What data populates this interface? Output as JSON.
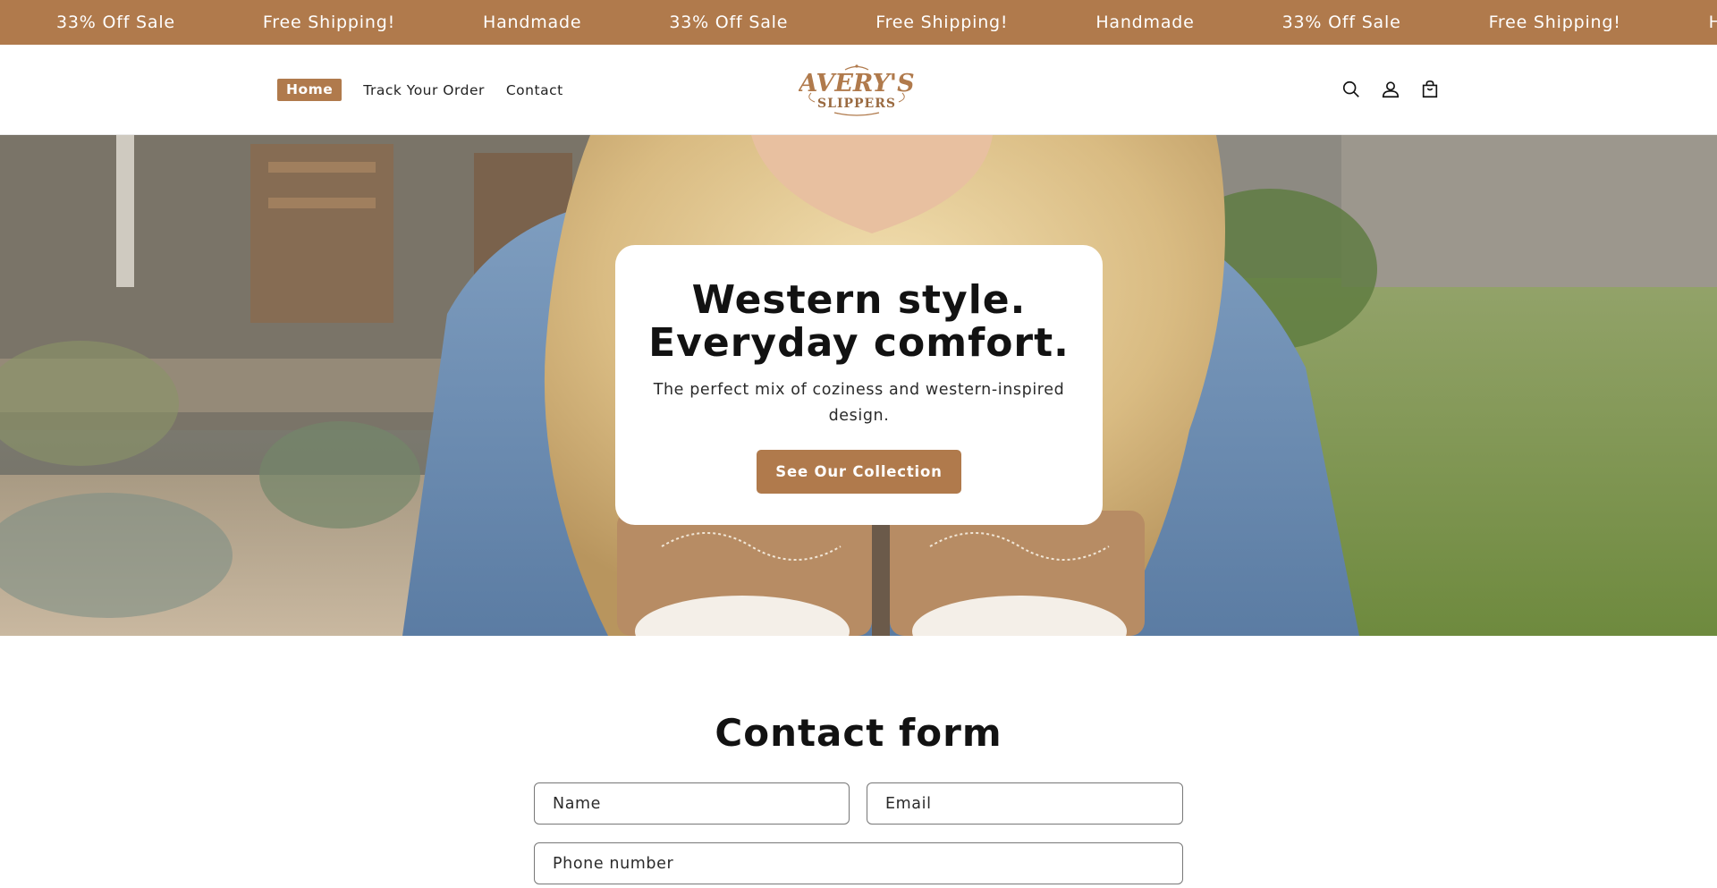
{
  "announcement": {
    "items": [
      "33% Off Sale",
      "Free Shipping!",
      "Handmade",
      "33% Off Sale",
      "Free Shipping!",
      "Handmade",
      "33% Off Sale",
      "Free Shipping!",
      "Handmade"
    ],
    "bg_color": "#b07a4c"
  },
  "nav": {
    "items": [
      {
        "label": "Home",
        "active": true
      },
      {
        "label": "Track Your Order",
        "active": false
      },
      {
        "label": "Contact",
        "active": false
      }
    ]
  },
  "logo": {
    "line1": "AVERY'S",
    "line2": "SLIPPERS"
  },
  "header_icons": [
    "search-icon",
    "account-icon",
    "cart-icon"
  ],
  "hero": {
    "title_line1": "Western style.",
    "title_line2": "Everyday comfort.",
    "subtitle": "The perfect mix of coziness and western-inspired design.",
    "button_label": "See Our Collection"
  },
  "contact": {
    "title": "Contact form",
    "name_placeholder": "Name",
    "email_placeholder": "Email",
    "phone_placeholder": "Phone number"
  },
  "colors": {
    "accent": "#b07a4c",
    "text": "#121212"
  }
}
